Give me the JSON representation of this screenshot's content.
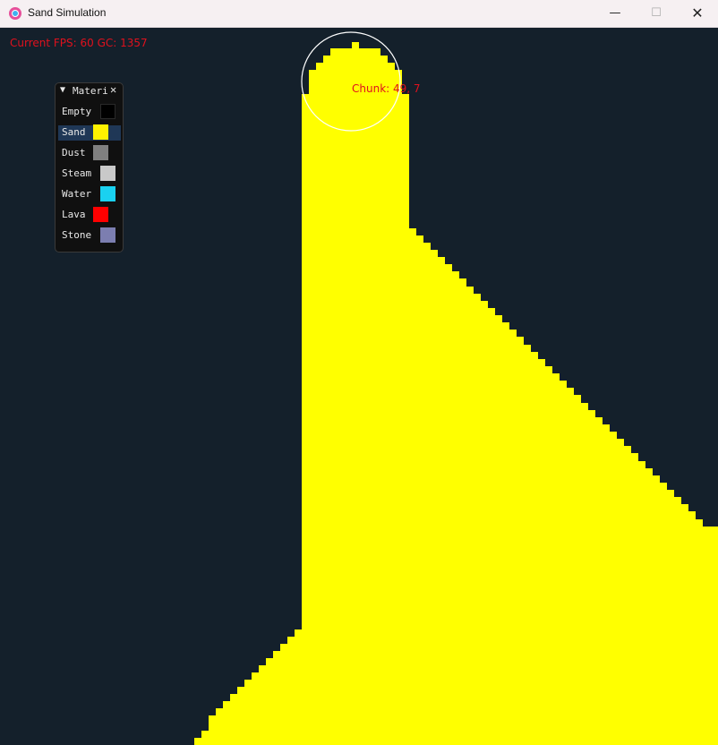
{
  "window": {
    "title": "Sand Simulation",
    "minimize_glyph": "—",
    "maximize_glyph": "☐",
    "close_glyph": "✕",
    "icon": "app-logo-icon"
  },
  "hud": {
    "fps_text": "Current FPS: 60 GC: 1357",
    "chunk_text": "Chunk: 49, 7",
    "color": "#e0111d"
  },
  "material_panel": {
    "title": "Materi",
    "collapse_glyph": "▼",
    "close_glyph": "✕",
    "selected": "Sand",
    "materials": [
      {
        "label": "Empty",
        "color": "#000000"
      },
      {
        "label": "Sand",
        "color": "#fff200"
      },
      {
        "label": "Dust",
        "color": "#808080"
      },
      {
        "label": "Steam",
        "color": "#c9c9c9"
      },
      {
        "label": "Water",
        "color": "#1ad1f0"
      },
      {
        "label": "Lava",
        "color": "#ff0000"
      },
      {
        "label": "Stone",
        "color": "#7c7eb0"
      }
    ]
  },
  "simulation": {
    "background_color": "#14202b",
    "sand_color": "#ffff00",
    "brush_cursor_color": "#ffffff"
  }
}
